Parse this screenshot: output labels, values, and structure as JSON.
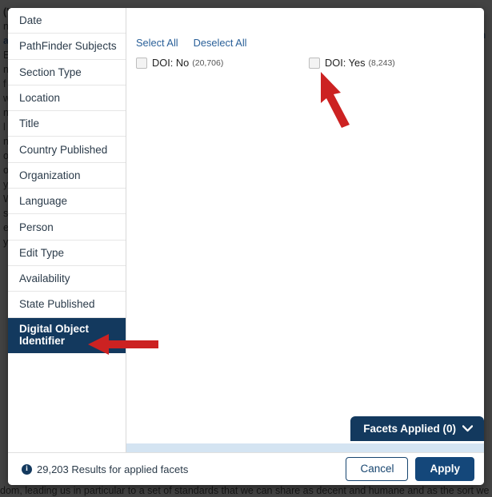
{
  "background_page": {
    "lines": [
      "(\"",
      "",
      "ns",
      "",
      "ad",
      "",
      "EP",
      "na",
      "f r",
      "w",
      "ne",
      "l a",
      "nd",
      "of",
      "on",
      "yS",
      "Wa",
      "ste",
      "e e",
      "y",
      "dom, leading us in particular to a set of standards that we can share as decent and humane and as the sort we"
    ],
    "right_fragment": "en"
  },
  "modal": {
    "close_label": "×",
    "sidebar": {
      "items": [
        {
          "label": "Date",
          "active": false
        },
        {
          "label": "PathFinder Subjects",
          "active": false
        },
        {
          "label": "Section Type",
          "active": false
        },
        {
          "label": "Location",
          "active": false
        },
        {
          "label": "Title",
          "active": false
        },
        {
          "label": "Country Published",
          "active": false
        },
        {
          "label": "Organization",
          "active": false
        },
        {
          "label": "Language",
          "active": false
        },
        {
          "label": "Person",
          "active": false
        },
        {
          "label": "Edit Type",
          "active": false
        },
        {
          "label": "Availability",
          "active": false
        },
        {
          "label": "State Published",
          "active": false
        },
        {
          "label": "Digital Object Identifier",
          "active": true
        }
      ]
    },
    "panel": {
      "select_all_label": "Select All",
      "deselect_all_label": "Deselect All",
      "values": [
        {
          "label": "DOI: No",
          "count": "(20,706)",
          "checked": false
        },
        {
          "label": "DOI: Yes",
          "count": "(8,243)",
          "checked": false
        }
      ],
      "facets_applied_label": "Facets Applied (0)"
    },
    "footer": {
      "info_glyph": "i",
      "results_text": "29,203 Results for applied facets",
      "cancel_label": "Cancel",
      "apply_label": "Apply"
    }
  },
  "colors": {
    "navy": "#13395e",
    "apply_navy": "#14477a",
    "link_blue": "#2a6099",
    "strip_blue": "#d4e4f2",
    "annotation_red": "#cc2222"
  }
}
